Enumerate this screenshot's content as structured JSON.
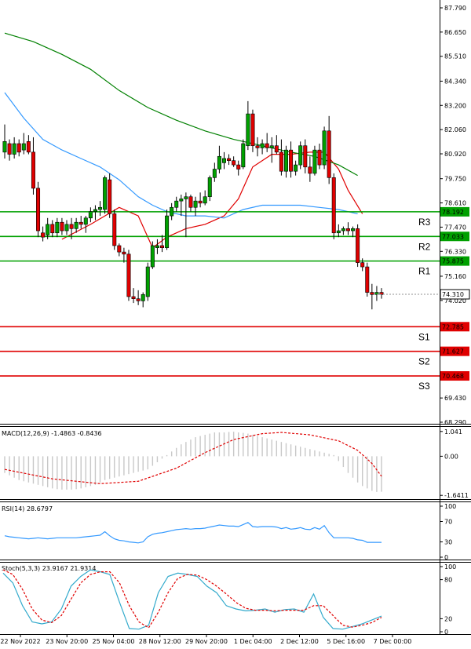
{
  "colors": {
    "bull": "#00a000",
    "bear": "#e00000",
    "ma_fast": "#e00000",
    "ma_mid": "#3399ff",
    "ma_slow": "#008000",
    "resistance": "#00a000",
    "support": "#e00000",
    "macd_hist": "#c8c8c8",
    "macd_signal": "#e00000",
    "rsi": "#3399ff",
    "stoch_k": "#33aacc",
    "stoch_d": "#e00000"
  },
  "chart_data": [
    {
      "type": "candlestick",
      "panel": "price",
      "ylim": [
        68.29,
        87.79
      ],
      "y_ticks": [
        "87.790",
        "86.650",
        "85.510",
        "84.340",
        "83.200",
        "82.060",
        "80.920",
        "79.750",
        "78.610",
        "77.470",
        "76.330",
        "75.160",
        "74.020",
        "69.430",
        "68.290"
      ],
      "x_labels": [
        "22 Nov 2022",
        "23 Nov 20:00",
        "25 Nov 04:00",
        "28 Nov 12:00",
        "29 Nov 20:00",
        "1 Dec 04:00",
        "2 Dec 12:00",
        "5 Dec 16:00",
        "7 Dec 00:00"
      ],
      "candles": [
        {
          "o": 81.0,
          "h": 82.3,
          "l": 80.7,
          "c": 81.5
        },
        {
          "o": 81.4,
          "h": 81.6,
          "l": 80.6,
          "c": 80.9
        },
        {
          "o": 80.9,
          "h": 81.7,
          "l": 80.7,
          "c": 81.4
        },
        {
          "o": 81.4,
          "h": 81.6,
          "l": 80.8,
          "c": 81.0
        },
        {
          "o": 81.1,
          "h": 81.9,
          "l": 80.9,
          "c": 81.4
        },
        {
          "o": 81.5,
          "h": 81.8,
          "l": 80.9,
          "c": 81.0
        },
        {
          "o": 81.0,
          "h": 81.7,
          "l": 79.0,
          "c": 79.3
        },
        {
          "o": 79.3,
          "h": 79.6,
          "l": 77.0,
          "c": 77.3
        },
        {
          "o": 77.2,
          "h": 77.5,
          "l": 76.8,
          "c": 77.0
        },
        {
          "o": 77.1,
          "h": 77.9,
          "l": 76.9,
          "c": 77.6
        },
        {
          "o": 77.6,
          "h": 77.8,
          "l": 77.0,
          "c": 77.2
        },
        {
          "o": 77.2,
          "h": 77.9,
          "l": 77.0,
          "c": 77.7
        },
        {
          "o": 77.7,
          "h": 77.9,
          "l": 77.1,
          "c": 77.3
        },
        {
          "o": 77.3,
          "h": 77.8,
          "l": 77.1,
          "c": 77.6
        },
        {
          "o": 77.6,
          "h": 77.9,
          "l": 76.9,
          "c": 77.4
        },
        {
          "o": 77.4,
          "h": 77.9,
          "l": 77.2,
          "c": 77.7
        },
        {
          "o": 77.7,
          "h": 78.0,
          "l": 77.4,
          "c": 77.6
        },
        {
          "o": 77.6,
          "h": 78.0,
          "l": 77.2,
          "c": 77.9
        },
        {
          "o": 77.9,
          "h": 78.4,
          "l": 77.7,
          "c": 78.2
        },
        {
          "o": 78.2,
          "h": 78.5,
          "l": 77.8,
          "c": 78.3
        },
        {
          "o": 78.3,
          "h": 78.7,
          "l": 78.0,
          "c": 78.4
        },
        {
          "o": 78.3,
          "h": 79.9,
          "l": 78.1,
          "c": 79.8
        },
        {
          "o": 79.7,
          "h": 80.0,
          "l": 77.9,
          "c": 78.1
        },
        {
          "o": 78.1,
          "h": 78.3,
          "l": 76.4,
          "c": 76.6
        },
        {
          "o": 76.6,
          "h": 76.7,
          "l": 76.1,
          "c": 76.3
        },
        {
          "o": 76.3,
          "h": 76.5,
          "l": 75.8,
          "c": 76.2
        },
        {
          "o": 76.2,
          "h": 76.4,
          "l": 74.0,
          "c": 74.2
        },
        {
          "o": 74.2,
          "h": 74.6,
          "l": 73.9,
          "c": 74.1
        },
        {
          "o": 74.1,
          "h": 74.5,
          "l": 73.8,
          "c": 74.0
        },
        {
          "o": 74.0,
          "h": 74.4,
          "l": 73.7,
          "c": 74.3
        },
        {
          "o": 74.2,
          "h": 75.8,
          "l": 74.0,
          "c": 75.6
        },
        {
          "o": 75.6,
          "h": 76.8,
          "l": 75.5,
          "c": 76.6
        },
        {
          "o": 76.5,
          "h": 76.9,
          "l": 76.2,
          "c": 76.6
        },
        {
          "o": 76.6,
          "h": 77.1,
          "l": 76.3,
          "c": 76.5
        },
        {
          "o": 76.5,
          "h": 78.3,
          "l": 76.4,
          "c": 78.0
        },
        {
          "o": 78.0,
          "h": 78.6,
          "l": 77.8,
          "c": 78.4
        },
        {
          "o": 78.4,
          "h": 78.9,
          "l": 78.2,
          "c": 78.7
        },
        {
          "o": 78.7,
          "h": 79.0,
          "l": 78.0,
          "c": 78.8
        },
        {
          "o": 78.8,
          "h": 79.1,
          "l": 77.0,
          "c": 78.9
        },
        {
          "o": 78.9,
          "h": 79.0,
          "l": 78.2,
          "c": 78.4
        },
        {
          "o": 78.4,
          "h": 78.9,
          "l": 78.0,
          "c": 78.7
        },
        {
          "o": 78.7,
          "h": 79.1,
          "l": 78.4,
          "c": 78.6
        },
        {
          "o": 78.6,
          "h": 79.2,
          "l": 78.5,
          "c": 78.9
        },
        {
          "o": 78.9,
          "h": 79.9,
          "l": 78.7,
          "c": 79.8
        },
        {
          "o": 79.8,
          "h": 80.5,
          "l": 79.6,
          "c": 80.2
        },
        {
          "o": 80.2,
          "h": 81.3,
          "l": 80.0,
          "c": 80.8
        },
        {
          "o": 80.5,
          "h": 81.0,
          "l": 80.2,
          "c": 80.7
        },
        {
          "o": 80.7,
          "h": 80.9,
          "l": 80.4,
          "c": 80.6
        },
        {
          "o": 80.6,
          "h": 80.8,
          "l": 80.3,
          "c": 80.4
        },
        {
          "o": 80.4,
          "h": 80.6,
          "l": 79.9,
          "c": 80.2
        },
        {
          "o": 80.3,
          "h": 81.6,
          "l": 80.2,
          "c": 81.4
        },
        {
          "o": 81.3,
          "h": 83.4,
          "l": 81.1,
          "c": 82.8
        },
        {
          "o": 82.8,
          "h": 83.0,
          "l": 81.0,
          "c": 81.3
        },
        {
          "o": 81.3,
          "h": 81.7,
          "l": 80.8,
          "c": 81.2
        },
        {
          "o": 81.2,
          "h": 81.6,
          "l": 80.9,
          "c": 81.4
        },
        {
          "o": 81.4,
          "h": 81.9,
          "l": 81.0,
          "c": 81.2
        },
        {
          "o": 81.2,
          "h": 81.7,
          "l": 80.5,
          "c": 81.3
        },
        {
          "o": 81.3,
          "h": 81.8,
          "l": 80.9,
          "c": 81.0
        },
        {
          "o": 81.0,
          "h": 81.6,
          "l": 79.9,
          "c": 80.1
        },
        {
          "o": 80.1,
          "h": 81.3,
          "l": 79.8,
          "c": 81.1
        },
        {
          "o": 81.1,
          "h": 81.5,
          "l": 79.8,
          "c": 80.1
        },
        {
          "o": 80.1,
          "h": 80.6,
          "l": 79.9,
          "c": 80.4
        },
        {
          "o": 80.4,
          "h": 81.5,
          "l": 80.2,
          "c": 81.3
        },
        {
          "o": 81.3,
          "h": 81.6,
          "l": 80.0,
          "c": 80.3
        },
        {
          "o": 80.3,
          "h": 80.8,
          "l": 79.6,
          "c": 80.0
        },
        {
          "o": 80.0,
          "h": 81.3,
          "l": 79.9,
          "c": 81.1
        },
        {
          "o": 81.1,
          "h": 81.4,
          "l": 80.2,
          "c": 80.4
        },
        {
          "o": 80.4,
          "h": 82.2,
          "l": 80.2,
          "c": 82.0
        },
        {
          "o": 82.0,
          "h": 82.7,
          "l": 79.5,
          "c": 79.8
        },
        {
          "o": 79.8,
          "h": 80.0,
          "l": 76.9,
          "c": 77.2
        },
        {
          "o": 77.2,
          "h": 77.6,
          "l": 77.0,
          "c": 77.3
        },
        {
          "o": 77.3,
          "h": 77.5,
          "l": 77.1,
          "c": 77.4
        },
        {
          "o": 77.4,
          "h": 77.7,
          "l": 77.1,
          "c": 77.3
        },
        {
          "o": 77.3,
          "h": 77.5,
          "l": 77.0,
          "c": 77.4
        },
        {
          "o": 77.4,
          "h": 77.6,
          "l": 75.6,
          "c": 75.8
        },
        {
          "o": 75.8,
          "h": 76.0,
          "l": 75.4,
          "c": 75.6
        },
        {
          "o": 75.6,
          "h": 75.8,
          "l": 74.2,
          "c": 74.4
        },
        {
          "o": 74.4,
          "h": 74.8,
          "l": 73.6,
          "c": 74.3
        },
        {
          "o": 74.3,
          "h": 74.7,
          "l": 74.0,
          "c": 74.4
        },
        {
          "o": 74.4,
          "h": 74.6,
          "l": 74.1,
          "c": 74.3
        }
      ],
      "moving_averages": [
        {
          "key": "fast",
          "points": [
            [
              12,
              76.9
            ],
            [
              18,
              77.6
            ],
            [
              24,
              78.4
            ],
            [
              28,
              78.0
            ],
            [
              31,
              76.5
            ],
            [
              34,
              77.0
            ],
            [
              38,
              77.4
            ],
            [
              42,
              77.6
            ],
            [
              46,
              78.0
            ],
            [
              49,
              78.8
            ],
            [
              52,
              80.3
            ],
            [
              56,
              80.9
            ],
            [
              60,
              80.9
            ],
            [
              64,
              81.0
            ],
            [
              67,
              81.0
            ],
            [
              70,
              80.2
            ],
            [
              72,
              79.2
            ],
            [
              75,
              78.1
            ]
          ]
        },
        {
          "key": "mid",
          "points": [
            [
              0,
              83.8
            ],
            [
              4,
              82.6
            ],
            [
              8,
              81.6
            ],
            [
              12,
              81.1
            ],
            [
              16,
              80.7
            ],
            [
              20,
              80.3
            ],
            [
              24,
              79.7
            ],
            [
              28,
              78.9
            ],
            [
              31,
              78.5
            ],
            [
              34,
              78.2
            ],
            [
              38,
              78.0
            ],
            [
              42,
              78.0
            ],
            [
              46,
              77.9
            ],
            [
              50,
              78.3
            ],
            [
              54,
              78.5
            ],
            [
              58,
              78.5
            ],
            [
              62,
              78.5
            ],
            [
              66,
              78.4
            ],
            [
              70,
              78.3
            ],
            [
              74,
              78.1
            ]
          ]
        },
        {
          "key": "slow",
          "points": [
            [
              0,
              86.6
            ],
            [
              6,
              86.2
            ],
            [
              12,
              85.6
            ],
            [
              18,
              84.9
            ],
            [
              24,
              83.9
            ],
            [
              30,
              83.1
            ],
            [
              36,
              82.5
            ],
            [
              42,
              82.0
            ],
            [
              48,
              81.6
            ],
            [
              54,
              81.3
            ],
            [
              60,
              81.0
            ],
            [
              65,
              80.8
            ],
            [
              70,
              80.4
            ],
            [
              74,
              79.9
            ]
          ]
        }
      ],
      "levels": [
        {
          "label": "R3",
          "value": 78.192,
          "value_text": "78.192",
          "kind": "resistance"
        },
        {
          "label": "R2",
          "value": 77.033,
          "value_text": "77.033",
          "kind": "resistance"
        },
        {
          "label": "R1",
          "value": 75.875,
          "value_text": "75.875",
          "kind": "resistance"
        },
        {
          "label": "S1",
          "value": 72.785,
          "value_text": "72.785",
          "kind": "support"
        },
        {
          "label": "S2",
          "value": 71.627,
          "value_text": "71.627",
          "kind": "support"
        },
        {
          "label": "S3",
          "value": 70.468,
          "value_text": "70.468",
          "kind": "support"
        }
      ],
      "current_price_text": "74.310",
      "current_price": 74.31
    },
    {
      "type": "bar",
      "panel": "macd",
      "title": "MACD(12,26,9) -1.4863 -0.8436",
      "ylim": [
        -1.7,
        1.1
      ],
      "y_ticks": [
        "1.041",
        "0.00",
        "-1.6411"
      ],
      "histogram": [
        -0.7,
        -0.8,
        -0.9,
        -1.0,
        -1.05,
        -1.1,
        -1.15,
        -1.2,
        -1.25,
        -1.3,
        -1.35,
        -1.38,
        -1.4,
        -1.4,
        -1.4,
        -1.38,
        -1.35,
        -1.3,
        -1.25,
        -1.2,
        -1.1,
        -1.0,
        -0.95,
        -0.9,
        -0.85,
        -0.8,
        -0.75,
        -0.7,
        -0.65,
        -0.6,
        -0.55,
        -0.4,
        -0.25,
        -0.1,
        0.05,
        0.2,
        0.35,
        0.5,
        0.6,
        0.7,
        0.8,
        0.85,
        0.9,
        0.95,
        1.0,
        1.0,
        1.0,
        1.02,
        1.03,
        1.0,
        0.98,
        0.95,
        0.9,
        0.85,
        0.8,
        0.75,
        0.7,
        0.65,
        0.6,
        0.55,
        0.5,
        0.45,
        0.4,
        0.35,
        0.3,
        0.25,
        0.2,
        0.15,
        0.1,
        0.05,
        -0.2,
        -0.45,
        -0.7,
        -0.9,
        -1.1,
        -1.25,
        -1.35,
        -1.45,
        -1.5,
        -1.49
      ],
      "signal_points": [
        [
          0,
          -0.55
        ],
        [
          10,
          -0.95
        ],
        [
          20,
          -1.15
        ],
        [
          28,
          -1.05
        ],
        [
          36,
          -0.5
        ],
        [
          42,
          0.15
        ],
        [
          48,
          0.7
        ],
        [
          54,
          0.95
        ],
        [
          58,
          1.0
        ],
        [
          64,
          0.9
        ],
        [
          70,
          0.65
        ],
        [
          74,
          0.25
        ],
        [
          77,
          -0.3
        ],
        [
          79,
          -0.84
        ]
      ]
    },
    {
      "type": "line",
      "panel": "rsi",
      "title": "RSI(14) 28.6797",
      "ylim": [
        0,
        100
      ],
      "y_ticks": [
        "100",
        "70",
        "30",
        "0"
      ],
      "values": [
        42,
        40,
        39,
        38,
        37,
        36,
        37,
        38,
        37,
        36,
        37,
        38,
        38,
        38,
        38,
        38,
        39,
        40,
        41,
        42,
        43,
        50,
        42,
        36,
        33,
        32,
        30,
        29,
        28,
        30,
        40,
        45,
        47,
        48,
        50,
        52,
        54,
        55,
        56,
        55,
        56,
        56,
        57,
        59,
        61,
        63,
        62,
        61,
        61,
        60,
        64,
        68,
        60,
        59,
        60,
        60,
        60,
        59,
        56,
        58,
        55,
        56,
        58,
        55,
        54,
        58,
        55,
        62,
        48,
        38,
        38,
        38,
        38,
        37,
        34,
        33,
        29,
        29,
        29,
        29
      ]
    },
    {
      "type": "line",
      "panel": "stochastic",
      "title": "Stoch(5,3,3) 23.9167 21.9314",
      "ylim": [
        0,
        100
      ],
      "y_ticks": [
        "100",
        "80",
        "20",
        "0"
      ],
      "k": [
        90,
        75,
        40,
        15,
        12,
        15,
        35,
        70,
        85,
        95,
        92,
        88,
        45,
        5,
        4,
        10,
        60,
        85,
        90,
        88,
        85,
        70,
        60,
        40,
        35,
        32,
        33,
        35,
        30,
        34,
        35,
        30,
        58,
        22,
        5,
        4,
        8,
        12,
        18,
        24
      ],
      "d": [
        95,
        88,
        65,
        35,
        18,
        14,
        25,
        50,
        75,
        88,
        92,
        92,
        75,
        40,
        15,
        6,
        30,
        60,
        82,
        88,
        87,
        80,
        70,
        58,
        45,
        36,
        33,
        33,
        32,
        33,
        33,
        33,
        40,
        40,
        25,
        10,
        7,
        10,
        14,
        22
      ]
    }
  ]
}
